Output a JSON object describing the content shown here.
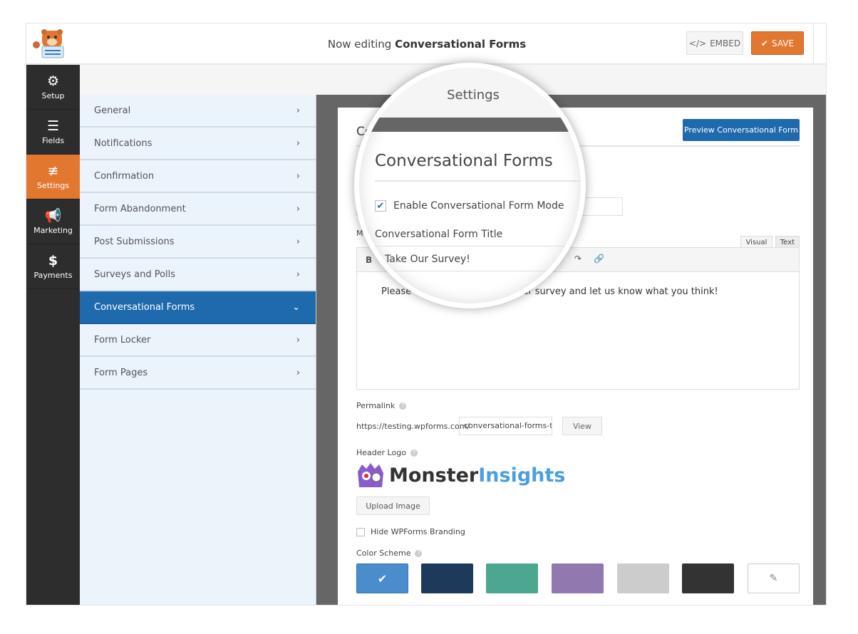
{
  "header": {
    "title_prefix": "Now editing",
    "title_form": "Conversational Forms",
    "embed_label": "EMBED",
    "save_label": "SAVE"
  },
  "nav": [
    {
      "label": "Setup",
      "icon": "gear-icon"
    },
    {
      "label": "Fields",
      "icon": "list-icon"
    },
    {
      "label": "Settings",
      "icon": "sliders-icon",
      "active": true
    },
    {
      "label": "Marketing",
      "icon": "megaphone-icon"
    },
    {
      "label": "Payments",
      "icon": "dollar-icon"
    }
  ],
  "submenu": [
    {
      "label": "General"
    },
    {
      "label": "Notifications"
    },
    {
      "label": "Confirmation"
    },
    {
      "label": "Form Abandonment"
    },
    {
      "label": "Post Submissions"
    },
    {
      "label": "Surveys and Polls"
    },
    {
      "label": "Conversational Forms",
      "active": true
    },
    {
      "label": "Form Locker"
    },
    {
      "label": "Form Pages"
    }
  ],
  "settings": {
    "panel_title": "Settings",
    "section_title": "Conversational Forms",
    "preview_label": "Preview Conversational Form",
    "enable_label": "Enable Conversational Form Mode",
    "enable_checked": true,
    "title_label": "Conversational Form Title",
    "title_value": "Take Our Survey!",
    "message_label": "Message",
    "tab_visual": "Visual",
    "tab_text": "Text",
    "message_value": "Please take a minute to take our survey and let us know what you think!",
    "permalink_label": "Permalink",
    "permalink_base": "https://testing.wpforms.com/",
    "permalink_slug": "conversational-forms-t",
    "view_label": "View",
    "header_logo_label": "Header Logo",
    "logo_text_a": "Monster",
    "logo_text_b": "Insights",
    "upload_label": "Upload Image",
    "hide_branding_label": "Hide WPForms Branding",
    "hide_branding_checked": false,
    "color_scheme_label": "Color Scheme",
    "colors": [
      "#4a8ccc",
      "#1e3a5a",
      "#4da690",
      "#9179b0",
      "#cccccc",
      "#333333"
    ],
    "selected_color": "#4a8ccc"
  }
}
